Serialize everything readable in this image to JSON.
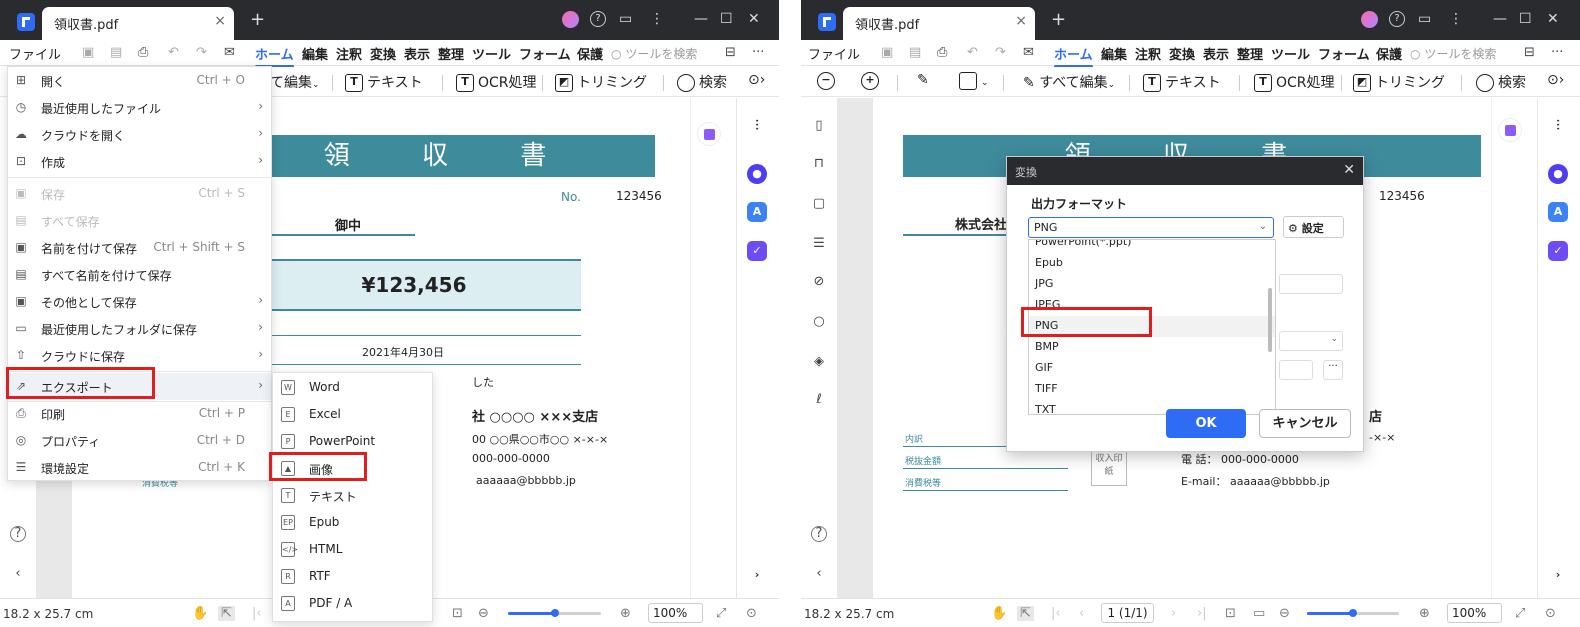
{
  "tab": {
    "title": "領収書.pdf",
    "close": "×",
    "add": "+"
  },
  "window_controls": {
    "help": "?",
    "minimize": "—",
    "maximize": "☐",
    "close": "✕",
    "more": "⋮"
  },
  "menubar": {
    "file": "ファイル",
    "items": [
      "ホーム",
      "編集",
      "注釈",
      "変換",
      "表示",
      "整理",
      "ツール",
      "フォーム",
      "保護"
    ],
    "active": "ホーム",
    "search_placeholder": "ツールを検索",
    "more": "···"
  },
  "toolbar": {
    "edit_all": "すべて編集",
    "edit_all_partial": "て編集",
    "text": "テキスト",
    "ocr": "OCR処理",
    "trim": "トリミング",
    "search": "検索"
  },
  "file_menu": {
    "items": [
      {
        "icon": "open-icon",
        "label": "開く",
        "shortcut": "Ctrl + O",
        "arrow": false,
        "disabled": false
      },
      {
        "icon": "clock-icon",
        "label": "最近使用したファイル",
        "shortcut": "",
        "arrow": true,
        "disabled": false
      },
      {
        "icon": "cloud-icon",
        "label": "クラウドを開く",
        "shortcut": "",
        "arrow": true,
        "disabled": false
      },
      {
        "icon": "create-icon",
        "label": "作成",
        "shortcut": "",
        "arrow": true,
        "disabled": false
      },
      {
        "icon": "save-icon",
        "label": "保存",
        "shortcut": "Ctrl + S",
        "arrow": false,
        "disabled": true
      },
      {
        "icon": "save-all-icon",
        "label": "すべて保存",
        "shortcut": "",
        "arrow": false,
        "disabled": true
      },
      {
        "icon": "save-as-icon",
        "label": "名前を付けて保存",
        "shortcut": "Ctrl + Shift + S",
        "arrow": false,
        "disabled": false
      },
      {
        "icon": "save-all-as-icon",
        "label": "すべて名前を付けて保存",
        "shortcut": "",
        "arrow": false,
        "disabled": false
      },
      {
        "icon": "save-other-icon",
        "label": "その他として保存",
        "shortcut": "",
        "arrow": true,
        "disabled": false
      },
      {
        "icon": "folder-icon",
        "label": "最近使用したフォルダに保存",
        "shortcut": "",
        "arrow": true,
        "disabled": false
      },
      {
        "icon": "cloud-upload-icon",
        "label": "クラウドに保存",
        "shortcut": "",
        "arrow": true,
        "disabled": false
      },
      {
        "icon": "export-icon",
        "label": "エクスポート",
        "shortcut": "",
        "arrow": true,
        "disabled": false
      },
      {
        "icon": "print-icon",
        "label": "印刷",
        "shortcut": "Ctrl + P",
        "arrow": false,
        "disabled": false
      },
      {
        "icon": "properties-icon",
        "label": "プロパティ",
        "shortcut": "Ctrl + D",
        "arrow": false,
        "disabled": false
      },
      {
        "icon": "settings-icon",
        "label": "環境設定",
        "shortcut": "Ctrl + K",
        "arrow": false,
        "disabled": false
      }
    ]
  },
  "export_submenu": {
    "items": [
      {
        "icon_letter": "W",
        "label": "Word"
      },
      {
        "icon_letter": "E",
        "label": "Excel"
      },
      {
        "icon_letter": "P",
        "label": "PowerPoint"
      },
      {
        "icon_letter": "▲",
        "label": "画像"
      },
      {
        "icon_letter": "T",
        "label": "テキスト"
      },
      {
        "icon_letter": "EP",
        "label": "Epub"
      },
      {
        "icon_letter": "</>",
        "label": "HTML"
      },
      {
        "icon_letter": "R",
        "label": "RTF"
      },
      {
        "icon_letter": "A",
        "label": "PDF / A"
      }
    ]
  },
  "receipt": {
    "title": "領 収 書",
    "no_label": "No.",
    "no_value": "123456",
    "addressee": "御中",
    "company_partial": "株式会社",
    "amount": "¥123,456",
    "date": "2021年4月30日",
    "received_partial": "した",
    "issuer": "社 ○○○○ ×××支店",
    "issuer_short": "店",
    "address": "00  ○○県○○市○○ ×-×-×",
    "address_short": "-×-×",
    "tel_value": "000-000-0000",
    "tel_label": "電 話：",
    "email_label": "E-mail：",
    "email_value": "aaaaaa@bbbbb.jp",
    "breakdown": "内訳",
    "subtotal": "税抜金額",
    "tax": "消費税等",
    "stamp": "収入印紙"
  },
  "status": {
    "size": "18.2 x 25.7 cm",
    "zoom": "100%",
    "zoom_fraction": 0.5,
    "page": "1 (1/1)"
  },
  "dialog": {
    "title": "変換",
    "close": "✕",
    "format_label": "出力フォーマット",
    "selected": "PNG",
    "settings": "設定",
    "options": [
      "PowerPoint(*.ppt)",
      "Epub",
      "JPG",
      "JPEG",
      "PNG",
      "BMP",
      "GIF",
      "TIFF",
      "TXT"
    ],
    "ok": "OK",
    "cancel": "キャンセル"
  },
  "colors": {
    "accent": "#2f6cf5",
    "highlight_red": "#e01e1e",
    "receipt_teal": "#3e8b9c",
    "titlebar": "#2a2b2f"
  }
}
